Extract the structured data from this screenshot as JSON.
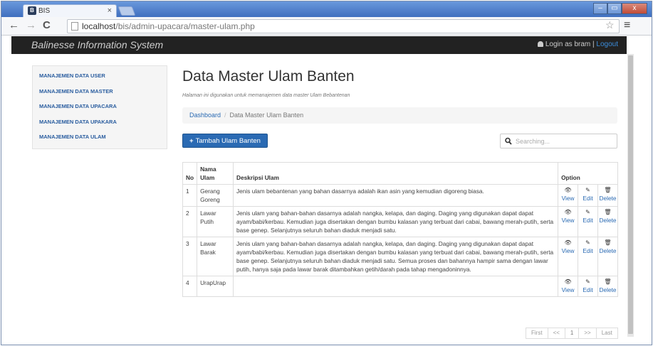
{
  "browser": {
    "tab_title": "BIS",
    "tab_favicon": "B",
    "tab_close": "×",
    "url_host": "localhost",
    "url_path": "/bis/admin-upacara/master-ulam.php",
    "win_minimize": "–",
    "win_restore": "▭",
    "win_close": "x"
  },
  "navbar": {
    "brand": "Balinesse Information System",
    "login_text": "Login as bram | ",
    "logout": "Logout"
  },
  "sidebar": {
    "items": [
      {
        "label": "MANAJEMEN DATA USER"
      },
      {
        "label": "MANAJEMEN DATA MASTER"
      },
      {
        "label": "MANAJEMEN DATA UPACARA"
      },
      {
        "label": "MANAJEMEN DATA UPAKARA"
      },
      {
        "label": "MANAJEMEN DATA ULAM"
      }
    ]
  },
  "main": {
    "title": "Data Master Ulam Banten",
    "subtitle": "Halaman ini digunakan untuk memanajemen data master Ulam Bebantenan",
    "breadcrumb": {
      "home": "Dashboard",
      "separator": "/",
      "current": "Data Master Ulam Banten"
    },
    "add_button": "Tambah Ulam Banten",
    "search_placeholder": "Searching..."
  },
  "table": {
    "headers": {
      "no": "No",
      "name": "Nama Ulam",
      "desc": "Deskripsi Ulam",
      "option": "Option"
    },
    "actions": {
      "view": "View",
      "edit": "Edit",
      "delete": "Delete"
    },
    "rows": [
      {
        "no": "1",
        "name": "Gerang Goreng",
        "desc": "Jenis ulam bebantenan yang bahan dasarnya adalah ikan asin yang kemudian digoreng biasa."
      },
      {
        "no": "2",
        "name": "Lawar Putih",
        "desc": "Jenis ulam yang bahan-bahan dasarnya adalah nangka, kelapa, dan daging. Daging yang digunakan dapat dapat ayam/babi/kerbau. Kemudian juga disertakan dengan bumbu kalasan yang terbuat dari cabai, bawang merah-putih, serta base genep. Selanjutnya seluruh bahan diaduk menjadi satu."
      },
      {
        "no": "3",
        "name": "Lawar Barak",
        "desc": "Jenis ulam yang bahan-bahan dasarnya adalah nangka, kelapa, dan daging. Daging yang digunakan dapat dapat ayam/babi/kerbau. Kemudian juga disertakan dengan bumbu kalasan yang terbuat dari cabai, bawang merah-putih, serta base genep. Selanjutnya seluruh bahan diaduk menjadi satu. Semua proses dan bahannya hampir sama dengan lawar putih, hanya saja pada lawar barak ditambahkan getih/darah pada tahap mengadoninnya."
      },
      {
        "no": "4",
        "name": "UrapUrap",
        "desc": ""
      }
    ]
  },
  "pagination": {
    "first": "First",
    "prev": "<<",
    "page": "1",
    "next": ">>",
    "last": "Last"
  }
}
